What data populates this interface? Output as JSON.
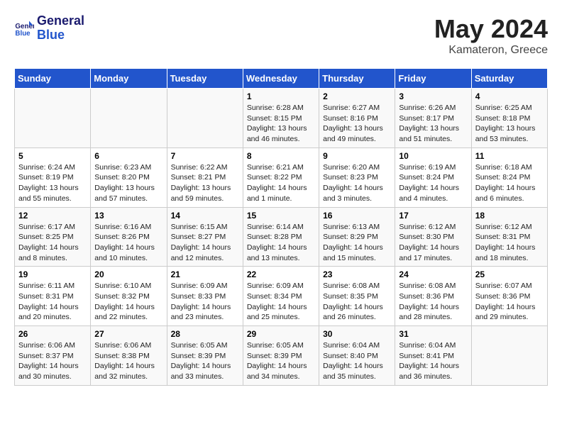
{
  "header": {
    "logo_general": "General",
    "logo_blue": "Blue",
    "month_title": "May 2024",
    "subtitle": "Kamateron, Greece"
  },
  "days_of_week": [
    "Sunday",
    "Monday",
    "Tuesday",
    "Wednesday",
    "Thursday",
    "Friday",
    "Saturday"
  ],
  "weeks": [
    [
      {
        "day": "",
        "info": ""
      },
      {
        "day": "",
        "info": ""
      },
      {
        "day": "",
        "info": ""
      },
      {
        "day": "1",
        "info": "Sunrise: 6:28 AM\nSunset: 8:15 PM\nDaylight: 13 hours\nand 46 minutes."
      },
      {
        "day": "2",
        "info": "Sunrise: 6:27 AM\nSunset: 8:16 PM\nDaylight: 13 hours\nand 49 minutes."
      },
      {
        "day": "3",
        "info": "Sunrise: 6:26 AM\nSunset: 8:17 PM\nDaylight: 13 hours\nand 51 minutes."
      },
      {
        "day": "4",
        "info": "Sunrise: 6:25 AM\nSunset: 8:18 PM\nDaylight: 13 hours\nand 53 minutes."
      }
    ],
    [
      {
        "day": "5",
        "info": "Sunrise: 6:24 AM\nSunset: 8:19 PM\nDaylight: 13 hours\nand 55 minutes."
      },
      {
        "day": "6",
        "info": "Sunrise: 6:23 AM\nSunset: 8:20 PM\nDaylight: 13 hours\nand 57 minutes."
      },
      {
        "day": "7",
        "info": "Sunrise: 6:22 AM\nSunset: 8:21 PM\nDaylight: 13 hours\nand 59 minutes."
      },
      {
        "day": "8",
        "info": "Sunrise: 6:21 AM\nSunset: 8:22 PM\nDaylight: 14 hours\nand 1 minute."
      },
      {
        "day": "9",
        "info": "Sunrise: 6:20 AM\nSunset: 8:23 PM\nDaylight: 14 hours\nand 3 minutes."
      },
      {
        "day": "10",
        "info": "Sunrise: 6:19 AM\nSunset: 8:24 PM\nDaylight: 14 hours\nand 4 minutes."
      },
      {
        "day": "11",
        "info": "Sunrise: 6:18 AM\nSunset: 8:24 PM\nDaylight: 14 hours\nand 6 minutes."
      }
    ],
    [
      {
        "day": "12",
        "info": "Sunrise: 6:17 AM\nSunset: 8:25 PM\nDaylight: 14 hours\nand 8 minutes."
      },
      {
        "day": "13",
        "info": "Sunrise: 6:16 AM\nSunset: 8:26 PM\nDaylight: 14 hours\nand 10 minutes."
      },
      {
        "day": "14",
        "info": "Sunrise: 6:15 AM\nSunset: 8:27 PM\nDaylight: 14 hours\nand 12 minutes."
      },
      {
        "day": "15",
        "info": "Sunrise: 6:14 AM\nSunset: 8:28 PM\nDaylight: 14 hours\nand 13 minutes."
      },
      {
        "day": "16",
        "info": "Sunrise: 6:13 AM\nSunset: 8:29 PM\nDaylight: 14 hours\nand 15 minutes."
      },
      {
        "day": "17",
        "info": "Sunrise: 6:12 AM\nSunset: 8:30 PM\nDaylight: 14 hours\nand 17 minutes."
      },
      {
        "day": "18",
        "info": "Sunrise: 6:12 AM\nSunset: 8:31 PM\nDaylight: 14 hours\nand 18 minutes."
      }
    ],
    [
      {
        "day": "19",
        "info": "Sunrise: 6:11 AM\nSunset: 8:31 PM\nDaylight: 14 hours\nand 20 minutes."
      },
      {
        "day": "20",
        "info": "Sunrise: 6:10 AM\nSunset: 8:32 PM\nDaylight: 14 hours\nand 22 minutes."
      },
      {
        "day": "21",
        "info": "Sunrise: 6:09 AM\nSunset: 8:33 PM\nDaylight: 14 hours\nand 23 minutes."
      },
      {
        "day": "22",
        "info": "Sunrise: 6:09 AM\nSunset: 8:34 PM\nDaylight: 14 hours\nand 25 minutes."
      },
      {
        "day": "23",
        "info": "Sunrise: 6:08 AM\nSunset: 8:35 PM\nDaylight: 14 hours\nand 26 minutes."
      },
      {
        "day": "24",
        "info": "Sunrise: 6:08 AM\nSunset: 8:36 PM\nDaylight: 14 hours\nand 28 minutes."
      },
      {
        "day": "25",
        "info": "Sunrise: 6:07 AM\nSunset: 8:36 PM\nDaylight: 14 hours\nand 29 minutes."
      }
    ],
    [
      {
        "day": "26",
        "info": "Sunrise: 6:06 AM\nSunset: 8:37 PM\nDaylight: 14 hours\nand 30 minutes."
      },
      {
        "day": "27",
        "info": "Sunrise: 6:06 AM\nSunset: 8:38 PM\nDaylight: 14 hours\nand 32 minutes."
      },
      {
        "day": "28",
        "info": "Sunrise: 6:05 AM\nSunset: 8:39 PM\nDaylight: 14 hours\nand 33 minutes."
      },
      {
        "day": "29",
        "info": "Sunrise: 6:05 AM\nSunset: 8:39 PM\nDaylight: 14 hours\nand 34 minutes."
      },
      {
        "day": "30",
        "info": "Sunrise: 6:04 AM\nSunset: 8:40 PM\nDaylight: 14 hours\nand 35 minutes."
      },
      {
        "day": "31",
        "info": "Sunrise: 6:04 AM\nSunset: 8:41 PM\nDaylight: 14 hours\nand 36 minutes."
      },
      {
        "day": "",
        "info": ""
      }
    ]
  ]
}
